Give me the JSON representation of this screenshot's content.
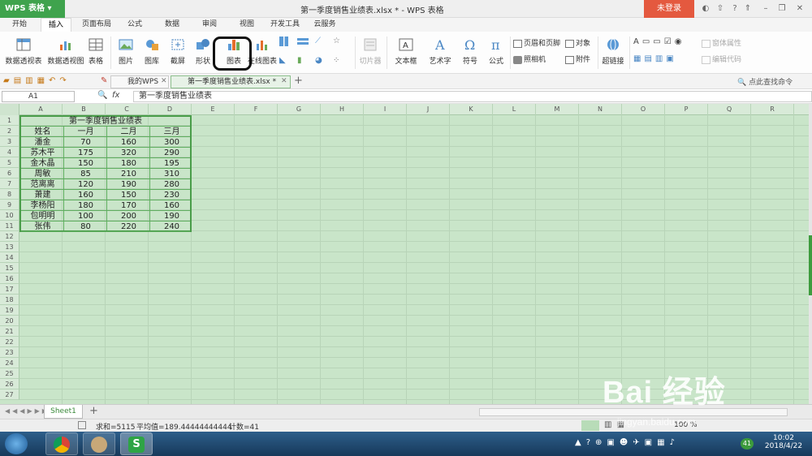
{
  "app": {
    "name": "WPS 表格",
    "doc_title": "第一季度销售业绩表.xlsx * - WPS 表格",
    "login": "未登录"
  },
  "menu_tabs": [
    "开始",
    "插入",
    "页面布局",
    "公式",
    "数据",
    "审阅",
    "视图",
    "开发工具",
    "云服务"
  ],
  "ribbon": {
    "big": [
      "数据透视表",
      "数据透视图",
      "表格",
      "图片",
      "图库",
      "截屏",
      "形状",
      "图表",
      "在线图表",
      "切片器",
      "文本框",
      "艺术字",
      "符号",
      "公式",
      "超链接"
    ],
    "small": [
      "页眉和页脚",
      "对象",
      "照相机",
      "附件",
      "窗体属性",
      "编辑代码"
    ]
  },
  "quick_tabs": [
    "我的WPS",
    "第一季度销售业绩表.xlsx *"
  ],
  "search_cmd": "点此查找命令",
  "formula": {
    "name_box": "A1",
    "fx": "fx",
    "value": "第一季度销售业绩表"
  },
  "columns": [
    "A",
    "B",
    "C",
    "D",
    "E",
    "F",
    "G",
    "H",
    "I",
    "J",
    "K",
    "L",
    "M",
    "N",
    "O",
    "P",
    "Q",
    "R"
  ],
  "row_count": 27,
  "table": {
    "title": "第一季度销售业绩表",
    "header": [
      "姓名",
      "一月",
      "二月",
      "三月"
    ],
    "rows": [
      [
        "潘金",
        "70",
        "160",
        "300"
      ],
      [
        "苏木平",
        "175",
        "320",
        "290"
      ],
      [
        "金木晶",
        "150",
        "180",
        "195"
      ],
      [
        "周敏",
        "85",
        "210",
        "310"
      ],
      [
        "范离离",
        "120",
        "190",
        "280"
      ],
      [
        "萧建",
        "160",
        "150",
        "230"
      ],
      [
        "李杨阳",
        "180",
        "170",
        "160"
      ],
      [
        "包明明",
        "100",
        "200",
        "190"
      ],
      [
        "张伟",
        "80",
        "220",
        "240"
      ]
    ]
  },
  "sheet": "Sheet1",
  "status": {
    "sum": "求和=5115",
    "avg": "平均值=189.44444444444",
    "count": "计数=41",
    "zoom": "100 %"
  },
  "clock": {
    "time": "10:02",
    "date": "2018/4/22"
  },
  "watermark": "Bai 经验",
  "watermark_url": "jingyan.baidu.com"
}
